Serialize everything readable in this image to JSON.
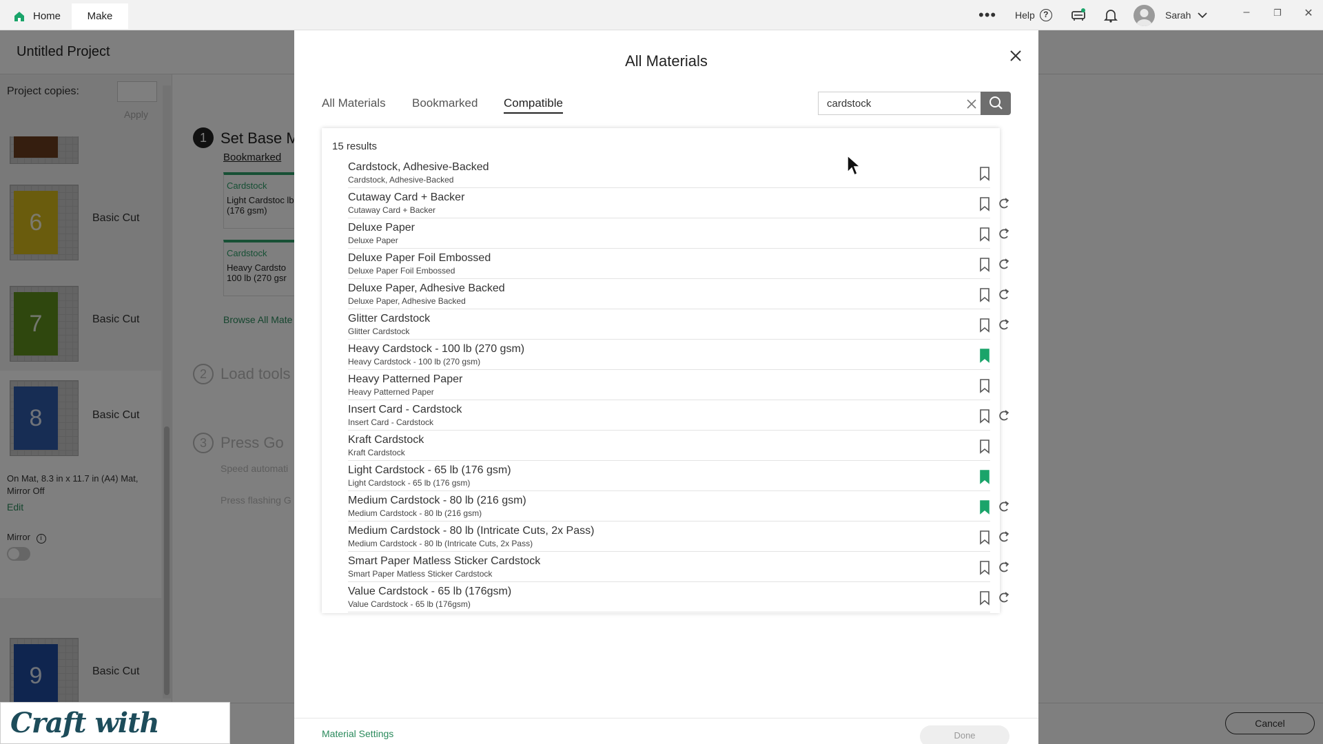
{
  "topbar": {
    "home_label": "Home",
    "make_label": "Make",
    "more_label": "•••",
    "help_label": "Help",
    "help_glyph": "?",
    "user_name": "Sarah",
    "icons": [
      "home-icon",
      "more-icon",
      "help-icon",
      "printer-icon",
      "bell-icon",
      "avatar",
      "chevron-down-icon",
      "minimize-icon",
      "restore-icon",
      "close-icon"
    ],
    "win_minimize": "–",
    "win_restore": "❐",
    "win_close": "✕"
  },
  "project": {
    "title": "Untitled Project",
    "copies_label": "Project copies:",
    "apply_label": "Apply",
    "mats": [
      {
        "num": "6",
        "label": "Basic Cut",
        "color": "#d4b81a"
      },
      {
        "num": "7",
        "label": "Basic Cut",
        "color": "#5f8e1d"
      },
      {
        "num": "8",
        "label": "Basic Cut",
        "color": "#2f5aa8"
      },
      {
        "num": "9",
        "label": "Basic Cut",
        "color": "#1f4a9e"
      }
    ],
    "mat_info": "On Mat, 8.3 in x 11.7 in (A4) Mat, Mirror Off",
    "edit_label": "Edit",
    "mirror_label": "Mirror",
    "mirror_on": false,
    "steps": {
      "step1_num": "1",
      "step1_title": "Set Base M",
      "bookmarked_label": "Bookmarked",
      "card1_cat": "Cardstock",
      "card1_name": "Light Cardstoc lb (176 gsm)",
      "card2_cat": "Cardstock",
      "card2_name": "Heavy Cardsto 100 lb (270 gsr",
      "browse_label": "Browse All Mate",
      "step2_num": "2",
      "step2_title": "Load tools",
      "step3_num": "3",
      "step3_title": "Press Go",
      "step3_line1": "Speed automati",
      "step3_line2": "Press flashing G"
    },
    "cancel_label": "Cancel"
  },
  "logo_text": "Craft with Sarah",
  "modal": {
    "title": "All Materials",
    "tabs": [
      {
        "label": "All Materials",
        "active": false
      },
      {
        "label": "Bookmarked",
        "active": false
      },
      {
        "label": "Compatible",
        "active": true
      }
    ],
    "search_value": "cardstock",
    "results_count": "15 results",
    "accent_color": "#1aa46a",
    "rows": [
      {
        "name": "Cardstock, Adhesive-Backed",
        "sub": "Cardstock, Adhesive-Backed",
        "bookmarked": false,
        "reload": false
      },
      {
        "name": "Cutaway Card + Backer",
        "sub": "Cutaway Card + Backer",
        "bookmarked": false,
        "reload": true
      },
      {
        "name": "Deluxe Paper",
        "sub": "Deluxe Paper",
        "bookmarked": false,
        "reload": true
      },
      {
        "name": "Deluxe Paper Foil Embossed",
        "sub": "Deluxe Paper Foil Embossed",
        "bookmarked": false,
        "reload": true
      },
      {
        "name": "Deluxe Paper, Adhesive Backed",
        "sub": "Deluxe Paper, Adhesive Backed",
        "bookmarked": false,
        "reload": true
      },
      {
        "name": "Glitter Cardstock",
        "sub": "Glitter Cardstock",
        "bookmarked": false,
        "reload": true
      },
      {
        "name": "Heavy Cardstock - 100 lb (270 gsm)",
        "sub": "Heavy Cardstock - 100 lb (270 gsm)",
        "bookmarked": true,
        "reload": false
      },
      {
        "name": "Heavy Patterned Paper",
        "sub": "Heavy Patterned Paper",
        "bookmarked": false,
        "reload": false
      },
      {
        "name": "Insert Card - Cardstock",
        "sub": "Insert Card - Cardstock",
        "bookmarked": false,
        "reload": true
      },
      {
        "name": "Kraft Cardstock",
        "sub": "Kraft Cardstock",
        "bookmarked": false,
        "reload": false
      },
      {
        "name": "Light Cardstock - 65 lb (176 gsm)",
        "sub": "Light Cardstock - 65 lb (176 gsm)",
        "bookmarked": true,
        "reload": false
      },
      {
        "name": "Medium Cardstock - 80 lb (216 gsm)",
        "sub": "Medium Cardstock - 80 lb (216 gsm)",
        "bookmarked": true,
        "reload": true
      },
      {
        "name": "Medium Cardstock - 80 lb (Intricate Cuts, 2x Pass)",
        "sub": "Medium Cardstock - 80 lb (Intricate Cuts, 2x Pass)",
        "bookmarked": false,
        "reload": true
      },
      {
        "name": "Smart Paper Matless Sticker Cardstock",
        "sub": "Smart Paper Matless Sticker Cardstock",
        "bookmarked": false,
        "reload": true
      },
      {
        "name": "Value Cardstock - 65 lb (176gsm)",
        "sub": "Value Cardstock - 65 lb (176gsm)",
        "bookmarked": false,
        "reload": true
      }
    ],
    "settings_label": "Material Settings",
    "done_label": "Done"
  }
}
